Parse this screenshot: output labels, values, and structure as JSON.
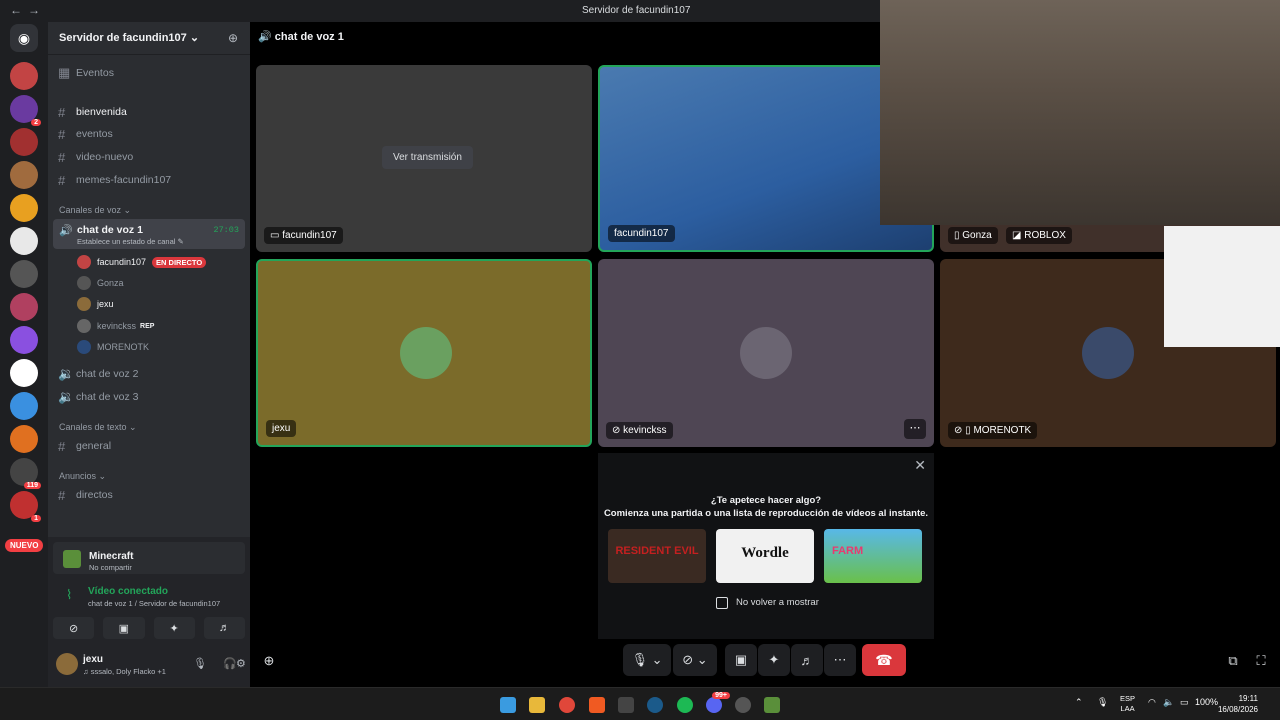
{
  "window": {
    "title": "Servidor de facundin107"
  },
  "server": {
    "name": "Servidor de facundin107 ⌄",
    "events": "Eventos",
    "channels": [
      "bienvenida",
      "eventos",
      "video-nuevo",
      "memes-facundin107"
    ],
    "voice_category": "Canales de voz ⌄",
    "active_voice": {
      "name": "chat de voz 1",
      "status_hint": "Establece un estado de canal ✎",
      "timer": "27:03"
    },
    "voice_users": [
      {
        "name": "facundin107",
        "badge": "EN DIRECTO"
      },
      {
        "name": "Gonza"
      },
      {
        "name": "jexu"
      },
      {
        "name": "kevinckss",
        "badge": "REP"
      },
      {
        "name": "MORENOTK"
      }
    ],
    "other_voice": [
      "chat de voz 2",
      "chat de voz 3"
    ],
    "text_category": "Canales de texto ⌄",
    "text_channels": [
      "general"
    ],
    "announce_category": "Anuncios ⌄",
    "announce_channels": [
      "directos"
    ]
  },
  "guild_badges": {
    "b1": "2",
    "b2": "119",
    "b3": "1",
    "nuevo": "NUEVO"
  },
  "activity_card": {
    "title": "Minecraft",
    "sub": "No compartir"
  },
  "voice_connection": {
    "title": "Vídeo conectado",
    "sub": "chat de voz 1 / Servidor de facundin107"
  },
  "user": {
    "name": "jexu",
    "status": "♫ sssalo, Doly Flacko +1"
  },
  "call": {
    "header": "chat de voz 1",
    "watch_btn": "Ver transmisión",
    "tiles": [
      {
        "label": "facundin107"
      },
      {
        "label": "facundin107"
      },
      {
        "label": "Gonza",
        "extra": "ROBLOX"
      },
      {
        "label": "jexu"
      },
      {
        "label": "kevinckss"
      },
      {
        "label": "MORENOTK"
      }
    ]
  },
  "activity_popup": {
    "q1": "¿Te apetece hacer algo?",
    "q2": "Comienza una partida o una lista de reproducción de vídeos al instante.",
    "games": [
      "RESIDENT EVIL",
      "Wordle",
      "FARM"
    ],
    "checkbox": "No volver a mostrar"
  },
  "taskbar": {
    "lang1": "ESP",
    "lang2": "LAA",
    "battery": "100%",
    "time": "19:11",
    "date": "16/08/2026",
    "badge": "99+"
  },
  "colors": {
    "accent_green": "#23a55a",
    "live_red": "#da373c",
    "bg": "#2b2d31"
  }
}
